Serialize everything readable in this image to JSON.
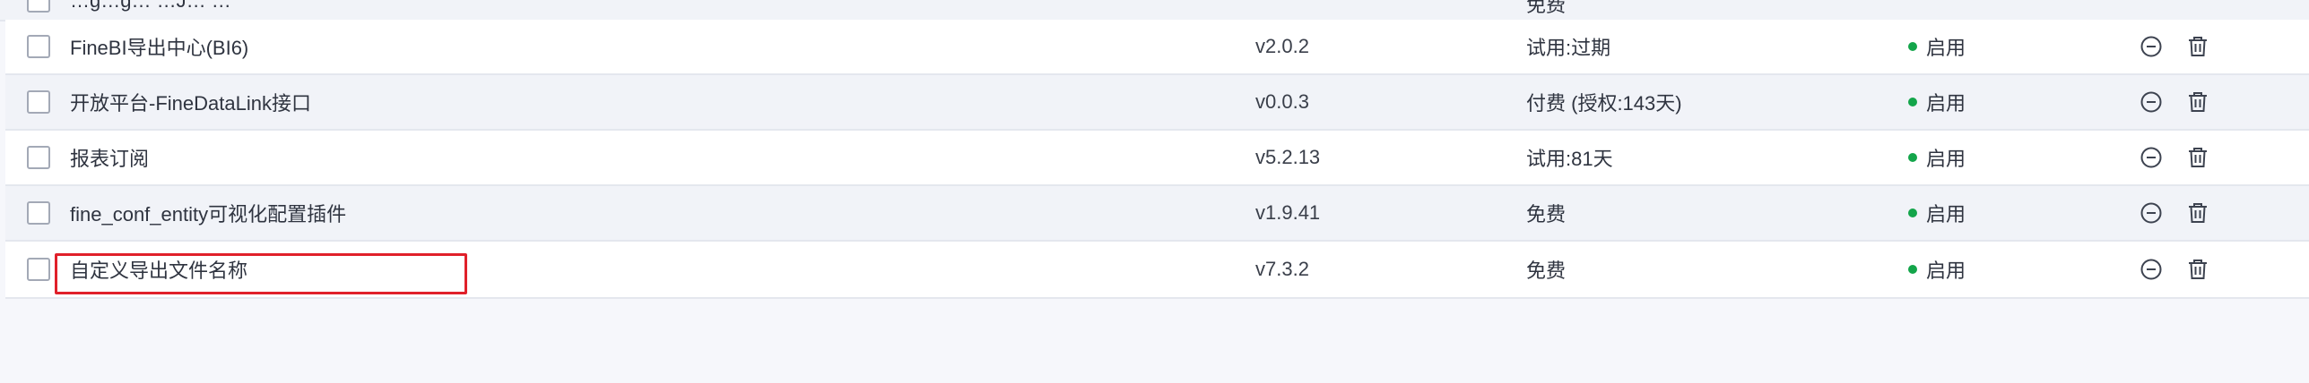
{
  "top_partial": {
    "name": "…g…g… …J… …",
    "license": "免费"
  },
  "rows": [
    {
      "name": "FineBI导出中心(BI6)",
      "version": "v2.0.2",
      "license": "试用:过期",
      "status": "启用"
    },
    {
      "name": "开放平台-FineDataLink接口",
      "version": "v0.0.3",
      "license": "付费 (授权:143天)",
      "status": "启用"
    },
    {
      "name": "报表订阅",
      "version": "v5.2.13",
      "license": "试用:81天",
      "status": "启用"
    },
    {
      "name": "fine_conf_entity可视化配置插件",
      "version": "v1.9.41",
      "license": "免费",
      "status": "启用"
    },
    {
      "name": "自定义导出文件名称",
      "version": "v7.3.2",
      "license": "免费",
      "status": "启用"
    }
  ],
  "colors": {
    "status_dot": "#13a54a",
    "highlight": "#e0202a"
  },
  "icons": {
    "disable": "minus-circle-icon",
    "delete": "trash-icon"
  }
}
